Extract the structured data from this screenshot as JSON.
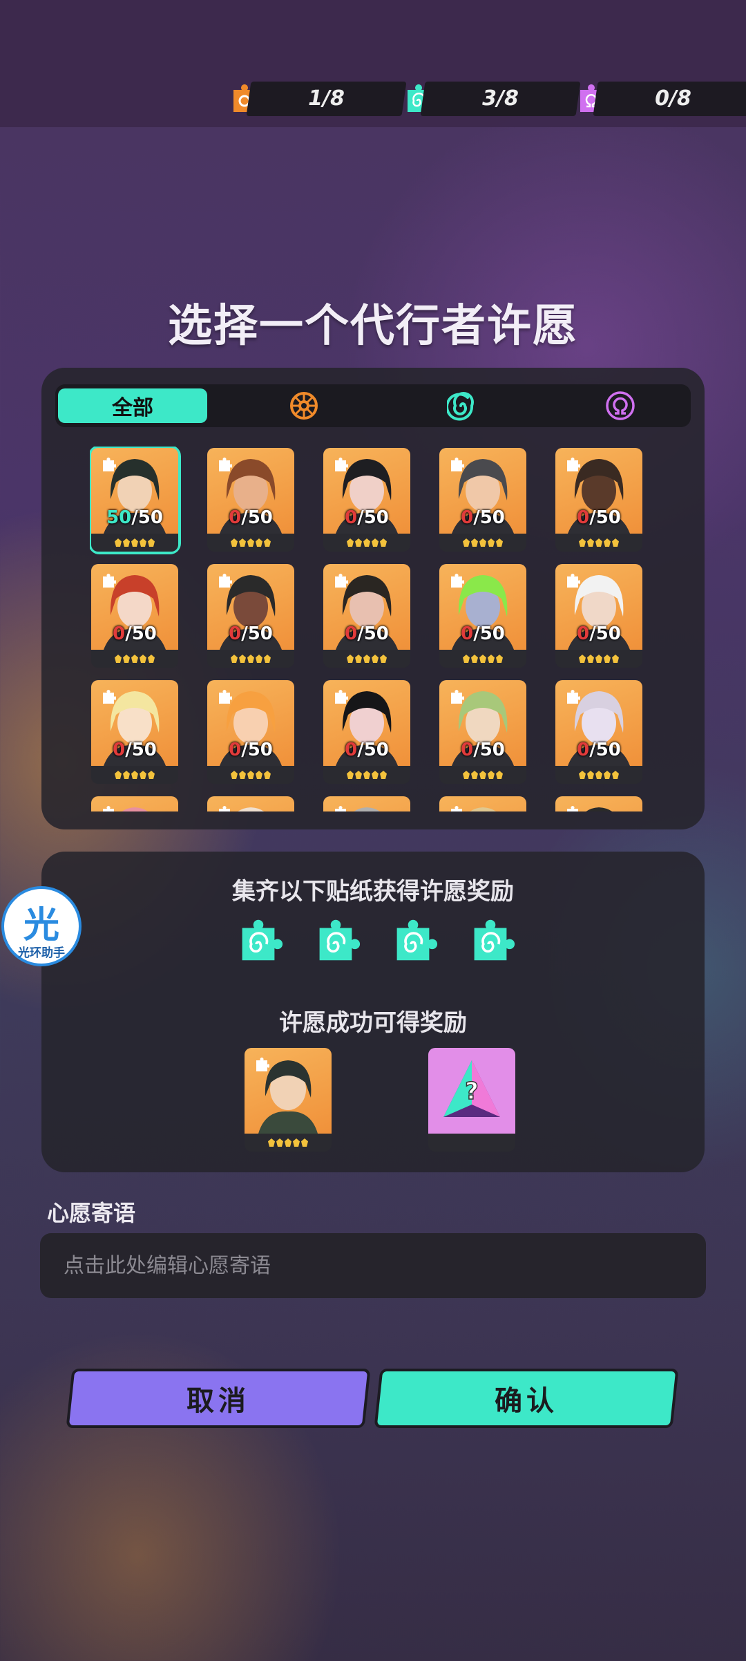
{
  "counters": [
    {
      "value": "1/8",
      "icon": "orange-sun-sticker-icon",
      "color": "#f08a2a"
    },
    {
      "value": "3/8",
      "icon": "green-swirl-sticker-icon",
      "color": "#3de8c8"
    },
    {
      "value": "0/8",
      "icon": "purple-omega-sticker-icon",
      "color": "#d070f0"
    }
  ],
  "title": "选择一个代行者许愿",
  "tabs": {
    "all": "全部",
    "icons": [
      "sun-tab-icon",
      "swirl-tab-icon",
      "omega-tab-icon"
    ],
    "colors": [
      "#f08a2a",
      "#3de8c8",
      "#d070f0"
    ]
  },
  "agents": [
    {
      "have": "50",
      "max": "/50",
      "selected": true
    },
    {
      "have": "0",
      "max": "/50"
    },
    {
      "have": "0",
      "max": "/50"
    },
    {
      "have": "0",
      "max": "/50"
    },
    {
      "have": "0",
      "max": "/50"
    },
    {
      "have": "0",
      "max": "/50"
    },
    {
      "have": "0",
      "max": "/50"
    },
    {
      "have": "0",
      "max": "/50"
    },
    {
      "have": "0",
      "max": "/50"
    },
    {
      "have": "0",
      "max": "/50"
    },
    {
      "have": "0",
      "max": "/50"
    },
    {
      "have": "0",
      "max": "/50"
    },
    {
      "have": "0",
      "max": "/50"
    },
    {
      "have": "0",
      "max": "/50"
    },
    {
      "have": "0",
      "max": "/50"
    }
  ],
  "collect": {
    "title": "集齐以下贴纸获得许愿奖励",
    "sticker_icon": "green-swirl-sticker-icon"
  },
  "reward": {
    "title": "许愿成功可得奖励",
    "item_icon": "mystery-prism-icon"
  },
  "wish": {
    "label": "心愿寄语",
    "placeholder": "点击此处编辑心愿寄语"
  },
  "buttons": {
    "cancel": "取消",
    "confirm": "确认"
  },
  "helper": {
    "char": "光",
    "label": "光环助手"
  },
  "colors": {
    "accent": "#3de8c8",
    "cancel": "#8a74f0",
    "zero": "#e23b3b"
  }
}
